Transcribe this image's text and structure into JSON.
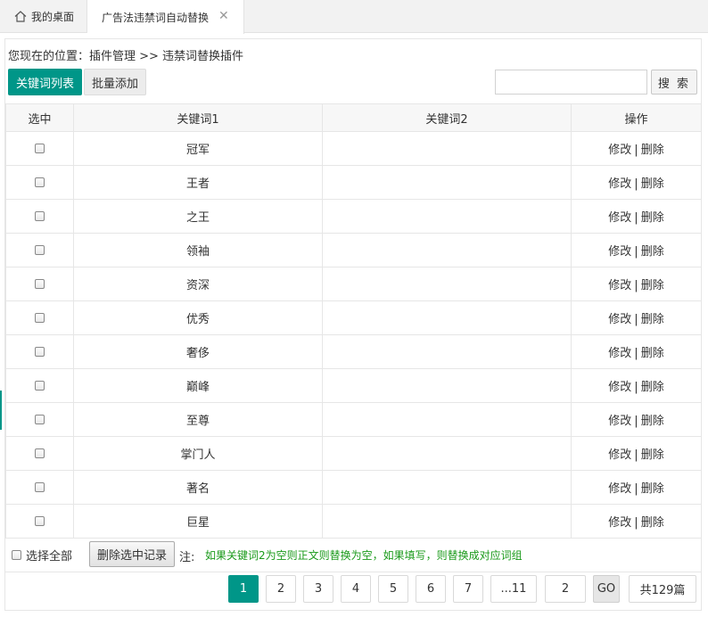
{
  "tabs": [
    {
      "label": "我的桌面",
      "icon": "home-icon"
    },
    {
      "label": "广告法违禁词自动替换",
      "icon": "close-icon",
      "close_glyph": "✕"
    }
  ],
  "breadcrumb": "您现在的位置：插件管理 >> 违禁词替换插件",
  "toolbar": {
    "list_label": "关键词列表",
    "batch_label": "批量添加",
    "search_placeholder": "",
    "search_label": "搜 索"
  },
  "table": {
    "headers": [
      "选中",
      "关键词1",
      "关键词2",
      "操作"
    ],
    "edit_label": "修改",
    "separator": "|",
    "delete_label": "删除",
    "rows": [
      {
        "kw1": "冠军",
        "kw2": ""
      },
      {
        "kw1": "王者",
        "kw2": ""
      },
      {
        "kw1": "之王",
        "kw2": ""
      },
      {
        "kw1": "领袖",
        "kw2": ""
      },
      {
        "kw1": "资深",
        "kw2": ""
      },
      {
        "kw1": "优秀",
        "kw2": ""
      },
      {
        "kw1": "奢侈",
        "kw2": ""
      },
      {
        "kw1": "巅峰",
        "kw2": ""
      },
      {
        "kw1": "至尊",
        "kw2": ""
      },
      {
        "kw1": "掌门人",
        "kw2": ""
      },
      {
        "kw1": "著名",
        "kw2": ""
      },
      {
        "kw1": "巨星",
        "kw2": ""
      }
    ]
  },
  "footer": {
    "select_all": "选择全部",
    "delete_selected": "删除选中记录",
    "note_label": "注:",
    "note": "如果关键词2为空则正文则替换为空，如果填写，则替换成对应词组"
  },
  "pager": {
    "pages": [
      "1",
      "2",
      "3",
      "4",
      "5",
      "6",
      "7",
      "...11"
    ],
    "current": "1",
    "goto_value": "2",
    "go_label": "GO",
    "total": "共129篇"
  },
  "colors": {
    "accent": "#009688",
    "note": "#1a9a1a"
  }
}
